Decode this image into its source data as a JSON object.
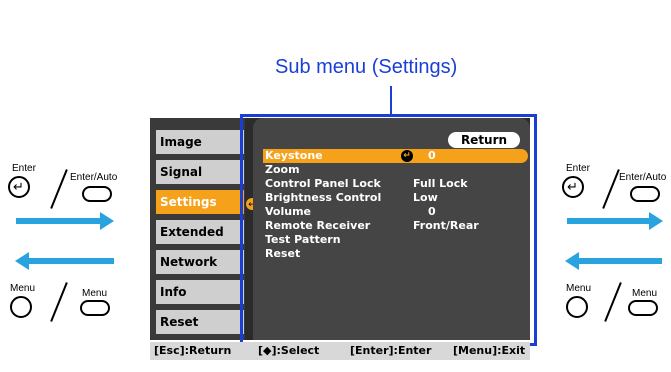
{
  "caption": "Sub menu (Settings)",
  "main_menu": [
    {
      "label": "Image",
      "active": false
    },
    {
      "label": "Signal",
      "active": false
    },
    {
      "label": "Settings",
      "active": true
    },
    {
      "label": "Extended",
      "active": false
    },
    {
      "label": "Network",
      "active": false
    },
    {
      "label": "Info",
      "active": false
    },
    {
      "label": "Reset",
      "active": false
    }
  ],
  "sub_menu": {
    "return_label": "Return",
    "items": [
      {
        "label": "Keystone",
        "value": "0",
        "active": true,
        "icon": "enter-icon"
      },
      {
        "label": "Zoom",
        "value": "",
        "active": false
      },
      {
        "label": "Control Panel Lock",
        "value": "Full Lock",
        "active": false
      },
      {
        "label": "Brightness Control",
        "value": "Low",
        "active": false
      },
      {
        "label": "Volume",
        "value": "0",
        "active": false
      },
      {
        "label": "Remote Receiver",
        "value": "Front/Rear",
        "active": false
      },
      {
        "label": "Test Pattern",
        "value": "",
        "active": false
      },
      {
        "label": "Reset",
        "value": "",
        "active": false
      }
    ]
  },
  "status_bar": {
    "esc": "[Esc]:Return",
    "select": "[◆]:Select",
    "enter": "[Enter]:Enter",
    "menu": "[Menu]:Exit"
  },
  "left_controls": {
    "enter_label": "Enter",
    "enter_auto_label": "Enter/Auto",
    "menu_label": "Menu",
    "menu_small_label": "Menu"
  },
  "right_controls": {
    "enter_label": "Enter",
    "enter_auto_label": "Enter/Auto",
    "menu_label": "Menu",
    "menu_small_label": "Menu"
  },
  "colors": {
    "accent_blue": "#1a3fd6",
    "arrow_blue": "#29a3e0",
    "highlight_orange": "#f5a11a"
  }
}
